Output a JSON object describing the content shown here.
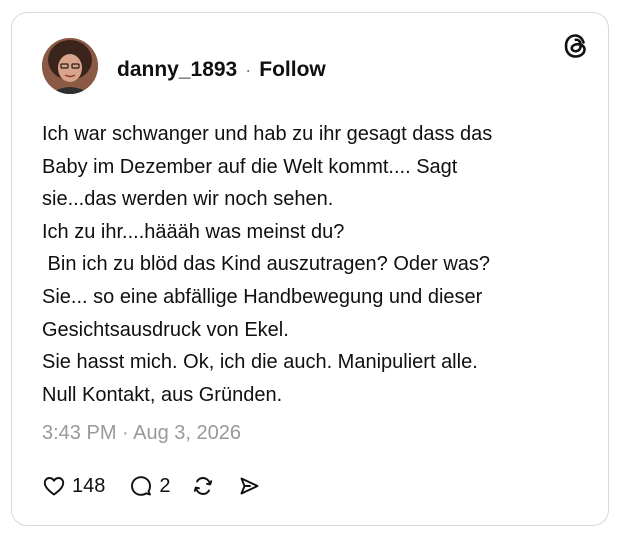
{
  "post": {
    "username": "danny_1893",
    "separator": "·",
    "follow_label": "Follow",
    "text_lines": [
      "Ich war schwanger und hab zu ihr gesagt dass das",
      "Baby im Dezember auf die Welt kommt.... Sagt",
      "sie...das werden wir noch sehen.",
      "Ich zu ihr....häääh was meinst du?",
      " Bin ich zu blöd das Kind auszutragen? Oder was?",
      "Sie... so eine abfällige Handbewegung und dieser",
      "Gesichtsausdruck von Ekel.",
      "Sie hasst mich. Ok, ich die auch. Manipuliert alle.",
      "Null Kontakt, aus Gründen."
    ],
    "timestamp": "3:43 PM · Aug 3, 2026",
    "likes": "148",
    "replies": "2"
  },
  "icons": {
    "brand": "threads-logo-icon",
    "like": "heart-icon",
    "reply": "comment-bubble-icon",
    "repost": "repost-arrows-icon",
    "share": "send-arrow-icon"
  },
  "colors": {
    "text": "#101010",
    "muted": "#999999",
    "border": "#d9d9d9"
  }
}
